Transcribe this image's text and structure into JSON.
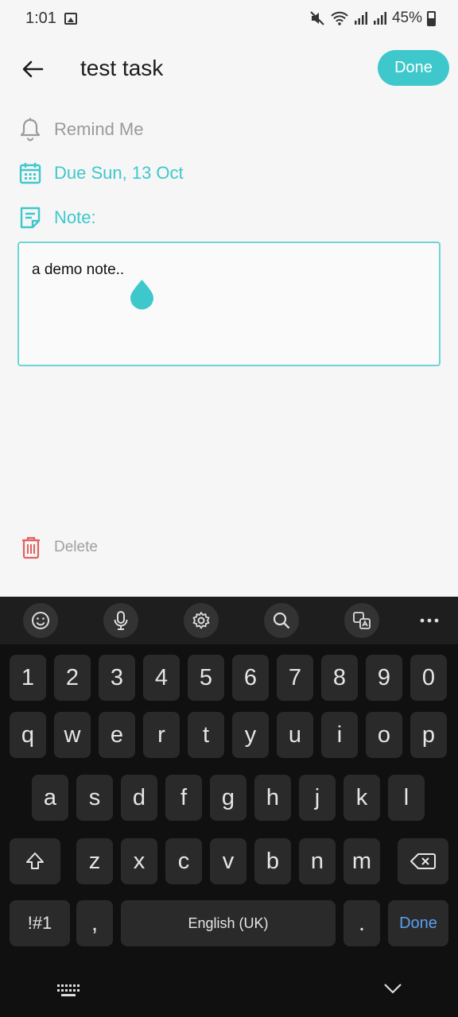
{
  "status": {
    "time": "1:01",
    "battery": "45%"
  },
  "header": {
    "title": "test task",
    "done_label": "Done"
  },
  "rows": {
    "remind_label": "Remind Me",
    "due_label": "Due Sun, 13 Oct",
    "note_label": "Note:"
  },
  "note": {
    "text": "a demo note.."
  },
  "delete_label": "Delete",
  "keyboard": {
    "numbers": [
      "1",
      "2",
      "3",
      "4",
      "5",
      "6",
      "7",
      "8",
      "9",
      "0"
    ],
    "row1": [
      "q",
      "w",
      "e",
      "r",
      "t",
      "y",
      "u",
      "i",
      "o",
      "p"
    ],
    "row2": [
      "a",
      "s",
      "d",
      "f",
      "g",
      "h",
      "j",
      "k",
      "l"
    ],
    "row3": [
      "z",
      "x",
      "c",
      "v",
      "b",
      "n",
      "m"
    ],
    "symbols_label": "!#1",
    "comma_label": ",",
    "space_label": "English (UK)",
    "period_label": ".",
    "action_label": "Done"
  },
  "colors": {
    "accent": "#3ec8cc",
    "delete": "#e36262",
    "keyboard_bg": "#101010"
  }
}
